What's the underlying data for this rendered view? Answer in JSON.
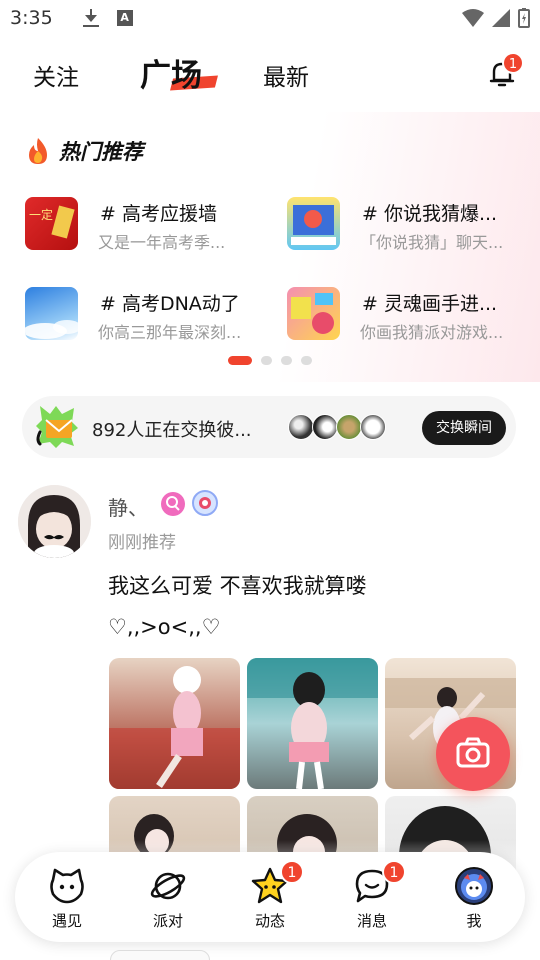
{
  "status": {
    "time": "3:35"
  },
  "top_tabs": {
    "follow": "关注",
    "square": "广场",
    "latest": "最新",
    "bell_badge": "1"
  },
  "hot": {
    "title": "热门推荐",
    "topics": [
      {
        "title": "# 高考应援墙",
        "subtitle": "又是一年高考季..."
      },
      {
        "title": "# 你说我猜爆...",
        "subtitle": "「你说我猜」聊天..."
      },
      {
        "title": "# 高考DNA动了",
        "subtitle": "你高三那年最深刻..."
      },
      {
        "title": "# 灵魂画手进...",
        "subtitle": "你画我猜派对游戏..."
      }
    ],
    "pages": 4,
    "active_page": 0
  },
  "exchange": {
    "text": "892人正在交换彼...",
    "button": "交换瞬间"
  },
  "post": {
    "username": "静、",
    "time": "刚刚推荐",
    "text": "我这么可爱 不喜欢我就算喽",
    "text2": "♡,,>o<,,♡"
  },
  "nav": {
    "items": [
      {
        "label": "遇见",
        "icon": "cat-face-icon"
      },
      {
        "label": "派对",
        "icon": "planet-icon"
      },
      {
        "label": "动态",
        "icon": "star-face-icon",
        "badge": "1"
      },
      {
        "label": "消息",
        "icon": "chat-bubble-icon",
        "badge": "1"
      },
      {
        "label": "我",
        "icon": "user-avatar-icon"
      }
    ]
  },
  "colors": {
    "accent": "#f0442e",
    "fab": "#f4545c",
    "dark_button": "#1a1a1a"
  }
}
